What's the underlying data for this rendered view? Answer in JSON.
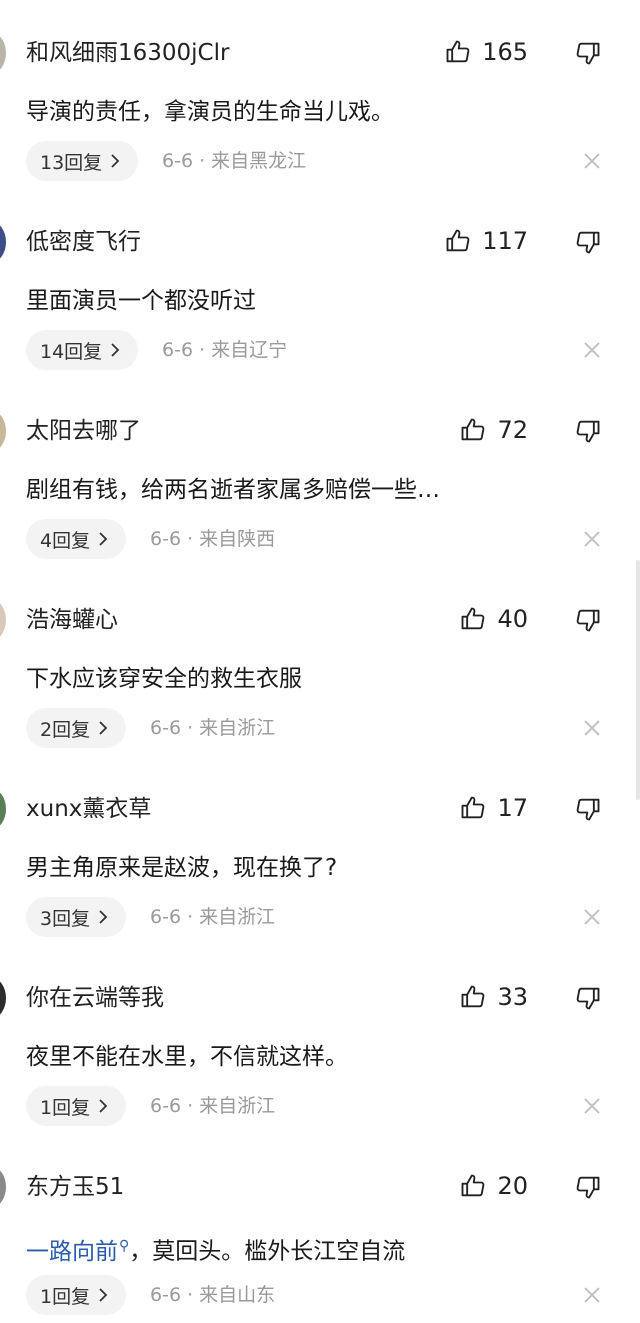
{
  "comments": [
    {
      "user": "和风细雨16300jClr",
      "likes": "165",
      "text": "导演的责任，拿演员的生命当儿戏。",
      "replies": "13回复",
      "meta": "6-6 · 来自黑龙江",
      "avatar_color": "#b9b3a8"
    },
    {
      "user": "低密度飞行",
      "likes": "117",
      "text": "里面演员一个都没听过",
      "replies": "14回复",
      "meta": "6-6 · 来自辽宁",
      "avatar_color": "#3d4e8a"
    },
    {
      "user": "太阳去哪了",
      "likes": "72",
      "text": "剧组有钱，给两名逝者家属多赔偿一些…",
      "replies": "4回复",
      "meta": "6-6 · 来自陕西",
      "avatar_color": "#c8b89a"
    },
    {
      "user": "浩海蠸心",
      "likes": "40",
      "text": "下水应该穿安全的救生衣服",
      "replies": "2回复",
      "meta": "6-6 · 来自浙江",
      "avatar_color": "#d9c7b8"
    },
    {
      "user": "xunx薰衣草",
      "likes": "17",
      "text": "男主角原来是赵波，现在换了?",
      "replies": "3回复",
      "meta": "6-6 · 来自浙江",
      "avatar_color": "#5a7f57"
    },
    {
      "user": "你在云端等我",
      "likes": "33",
      "text": "夜里不能在水里，不信就这样。",
      "replies": "1回复",
      "meta": "6-6 · 来自浙江",
      "avatar_color": "#2c2c2c"
    },
    {
      "user": "东方玉51",
      "likes": "20",
      "text_tag": "一路向前",
      "text_rest": "，莫回头。槛外长江空自流",
      "replies": "1回复",
      "meta": "6-6 · 来自山东",
      "avatar_color": "#8a8a8a"
    }
  ]
}
